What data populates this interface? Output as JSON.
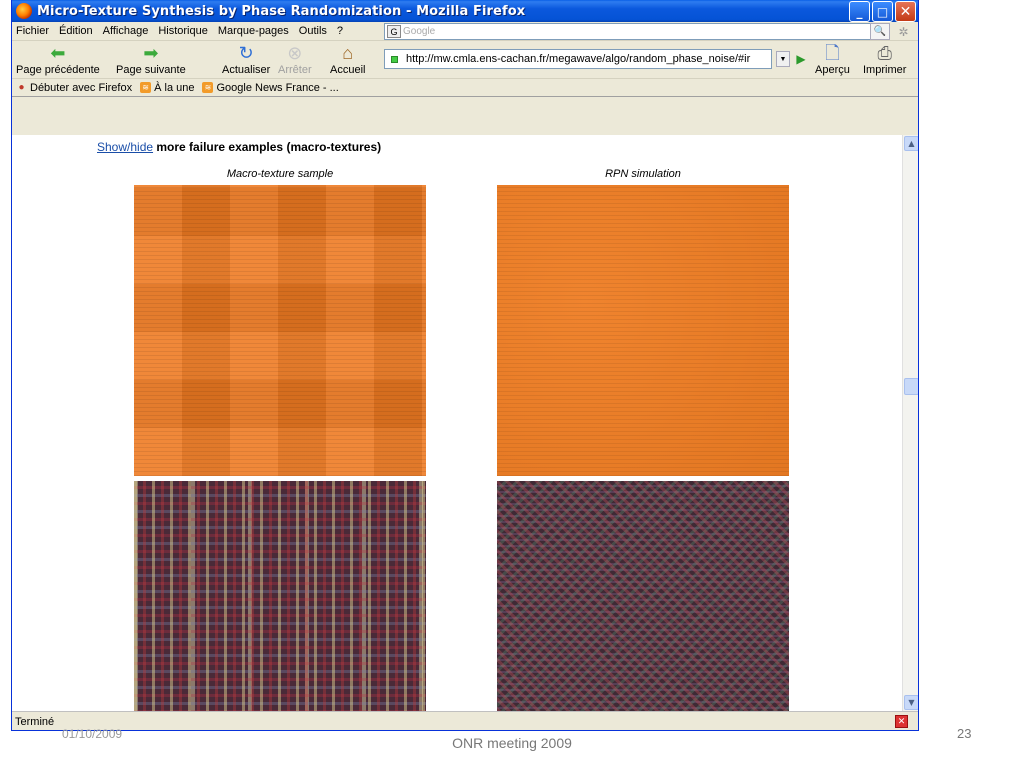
{
  "window": {
    "title": "Micro-Texture Synthesis by Phase Randomization - Mozilla Firefox",
    "controls": {
      "minimize": "_",
      "maximize": "□",
      "close": "✕"
    }
  },
  "menu": [
    "Fichier",
    "Édition",
    "Affichage",
    "Historique",
    "Marque-pages",
    "Outils",
    "?"
  ],
  "search": {
    "placeholder": "Google",
    "engine_icon": "G"
  },
  "toolbar": {
    "back": "Page précédente",
    "forward": "Page suivante",
    "reload": "Actualiser",
    "stop": "Arrêter",
    "home": "Accueil",
    "preview": "Aperçu",
    "print": "Imprimer"
  },
  "url": "http://mw.cmla.ens-cachan.fr/megawave/algo/random_phase_noise/#ir",
  "bookmarks": [
    "Débuter avec Firefox",
    "À la une",
    "Google News France - ..."
  ],
  "page": {
    "showhide_link": "Show/hide",
    "showhide_text": " more failure examples (macro-textures)",
    "caption_left": "Macro-texture sample",
    "caption_right": "RPN simulation"
  },
  "status": "Terminé",
  "slide": {
    "date": "01/10/2009",
    "title": "ONR meeting 2009",
    "page_number": "23"
  },
  "colors": {
    "titlebar": "#0553d6",
    "chrome": "#ece9d8",
    "link": "#1a4ea8",
    "texture_orange": "#ee7a22"
  },
  "icons": {
    "back": "green-left-arrow-icon",
    "forward": "green-right-arrow-icon",
    "reload": "reload-icon",
    "stop": "stop-icon",
    "home": "home-icon",
    "preview": "print-preview-icon",
    "print": "printer-icon"
  }
}
